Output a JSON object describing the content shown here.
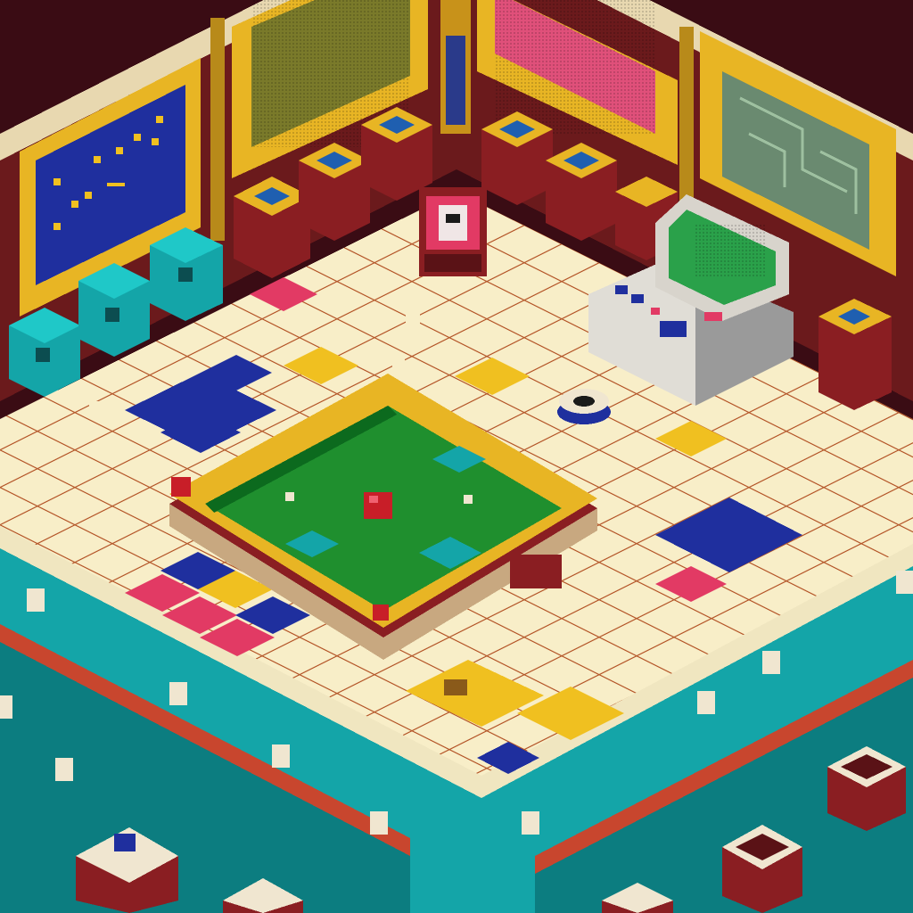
{
  "scene": {
    "title": "",
    "style": "isometric pixel-art game room",
    "palette": {
      "void": "#3a0c14",
      "wall_frame": "#e8b524",
      "wall_dark": "#6b1a1c",
      "floor": "#f8eec8",
      "floor_line": "#b5572a",
      "teal": "#14a5a8",
      "teal_dark": "#0c7d80",
      "blue": "#1f2f9e",
      "pink": "#e23a64",
      "yellow": "#f0c020",
      "green_field": "#1f8f2e",
      "maroon": "#8a1e22",
      "grey": "#d8d4cc",
      "green_screen": "#2aa14a"
    },
    "wall_panels": [
      {
        "id": "panel-blue",
        "color": "#1f2f9e"
      },
      {
        "id": "panel-olive",
        "color": "#7a7a2a"
      },
      {
        "id": "panel-pink",
        "color": "#e0507a"
      },
      {
        "id": "panel-map",
        "color": "#6a8a70"
      }
    ],
    "objects": [
      {
        "id": "central-game-table",
        "kind": "board",
        "interactable": true
      },
      {
        "id": "red-ball",
        "kind": "token",
        "interactable": true
      },
      {
        "id": "arcade-console",
        "kind": "terminal",
        "interactable": true
      },
      {
        "id": "red-robot",
        "kind": "character",
        "interactable": true
      },
      {
        "id": "floor-disc",
        "kind": "item",
        "interactable": true
      }
    ]
  }
}
